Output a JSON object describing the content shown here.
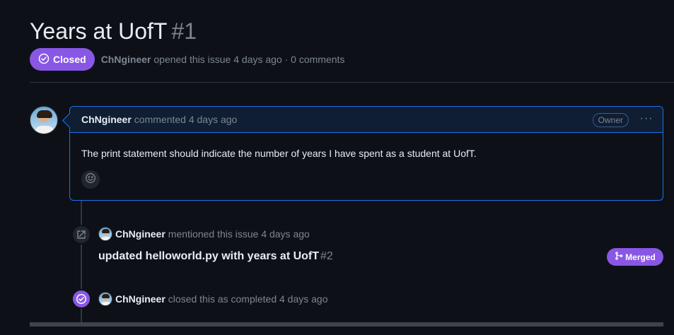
{
  "issue": {
    "title": "Years at UofT",
    "number": "#1",
    "state": "Closed",
    "author": "ChNgineer",
    "opened_text": "opened this issue 4 days ago · 0 comments"
  },
  "comment": {
    "author": "ChNgineer",
    "action": "commented 4 days ago",
    "role_badge": "Owner",
    "menu_glyph": "···",
    "body": "The print statement should indicate the number of years I have spent as a student at UofT."
  },
  "timeline": {
    "mention": {
      "author": "ChNgineer",
      "text": "mentioned this issue 4 days ago",
      "pr_title": "updated helloworld.py with years at UofT",
      "pr_number": "#2",
      "pr_state": "Merged"
    },
    "closed": {
      "author": "ChNgineer",
      "text": "closed this as completed 4 days ago"
    }
  },
  "colors": {
    "background": "#0d1117",
    "accent_purple": "#8957e5",
    "comment_border": "#1f6feb",
    "muted_text": "#7d8590"
  },
  "icons": {
    "state": "check-circle-icon",
    "reaction": "smiley-icon",
    "reference": "cross-reference-icon",
    "closed": "check-circle-icon",
    "merged": "git-merge-icon"
  }
}
